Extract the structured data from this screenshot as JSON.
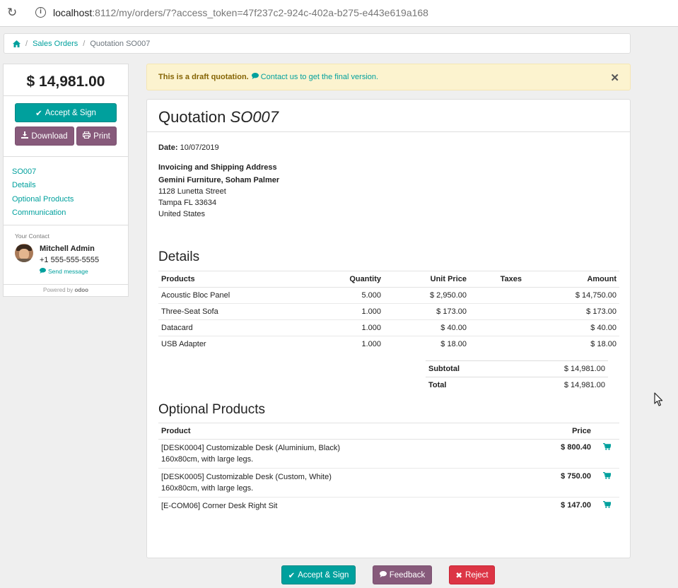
{
  "browser": {
    "url_host": "localhost",
    "url_rest": ":8112/my/orders/7?access_token=47f237c2-924c-402a-b275-e443e619a168"
  },
  "breadcrumb": {
    "sales_orders": "Sales Orders",
    "current": "Quotation SO007"
  },
  "sidebar": {
    "total": "$ 14,981.00",
    "accept_label": "Accept & Sign",
    "download_label": "Download",
    "print_label": "Print",
    "nav": [
      "SO007",
      "Details",
      "Optional Products",
      "Communication"
    ],
    "contact_label": "Your Contact",
    "contact_name": "Mitchell Admin",
    "contact_phone": "+1 555-555-5555",
    "send_message": "Send message",
    "powered_by": "Powered by",
    "odoo": "odoo"
  },
  "alert": {
    "bold": "This is a draft quotation.",
    "link": "Contact us to get the final version."
  },
  "quotation": {
    "title": "Quotation",
    "number": "SO007",
    "date_label": "Date:",
    "date": "10/07/2019",
    "address_title": "Invoicing and Shipping Address",
    "address_name": "Gemini Furniture, Soham Palmer",
    "address_lines": [
      "1128 Lunetta Street",
      "Tampa FL 33634",
      "United States"
    ]
  },
  "details": {
    "title": "Details",
    "headers": [
      "Products",
      "Quantity",
      "Unit Price",
      "Taxes",
      "Amount"
    ],
    "rows": [
      {
        "product": "Acoustic Bloc Panel",
        "qty": "5.000",
        "price": "$ 2,950.00",
        "taxes": "",
        "amount": "$ 14,750.00"
      },
      {
        "product": "Three-Seat Sofa",
        "qty": "1.000",
        "price": "$ 173.00",
        "taxes": "",
        "amount": "$ 173.00"
      },
      {
        "product": "Datacard",
        "qty": "1.000",
        "price": "$ 40.00",
        "taxes": "",
        "amount": "$ 40.00"
      },
      {
        "product": "USB Adapter",
        "qty": "1.000",
        "price": "$ 18.00",
        "taxes": "",
        "amount": "$ 18.00"
      }
    ],
    "subtotal_label": "Subtotal",
    "subtotal": "$ 14,981.00",
    "total_label": "Total",
    "total": "$ 14,981.00"
  },
  "optional": {
    "title": "Optional Products",
    "headers": [
      "Product",
      "Price"
    ],
    "rows": [
      {
        "line1": "[DESK0004] Customizable Desk (Aluminium, Black)",
        "line2": "160x80cm, with large legs.",
        "price": "$ 800.40"
      },
      {
        "line1": "[DESK0005] Customizable Desk (Custom, White)",
        "line2": "160x80cm, with large legs.",
        "price": "$ 750.00"
      },
      {
        "line1": "[E-COM06] Corner Desk Right Sit",
        "line2": "",
        "price": "$ 147.00"
      }
    ]
  },
  "bottom": {
    "accept_label": "Accept & Sign",
    "feedback_label": "Feedback",
    "reject_label": "Reject"
  },
  "colors": {
    "primary": "#00a09d",
    "secondary": "#875a7b",
    "danger": "#dc3545",
    "alert_bg": "#fcf3cf"
  }
}
